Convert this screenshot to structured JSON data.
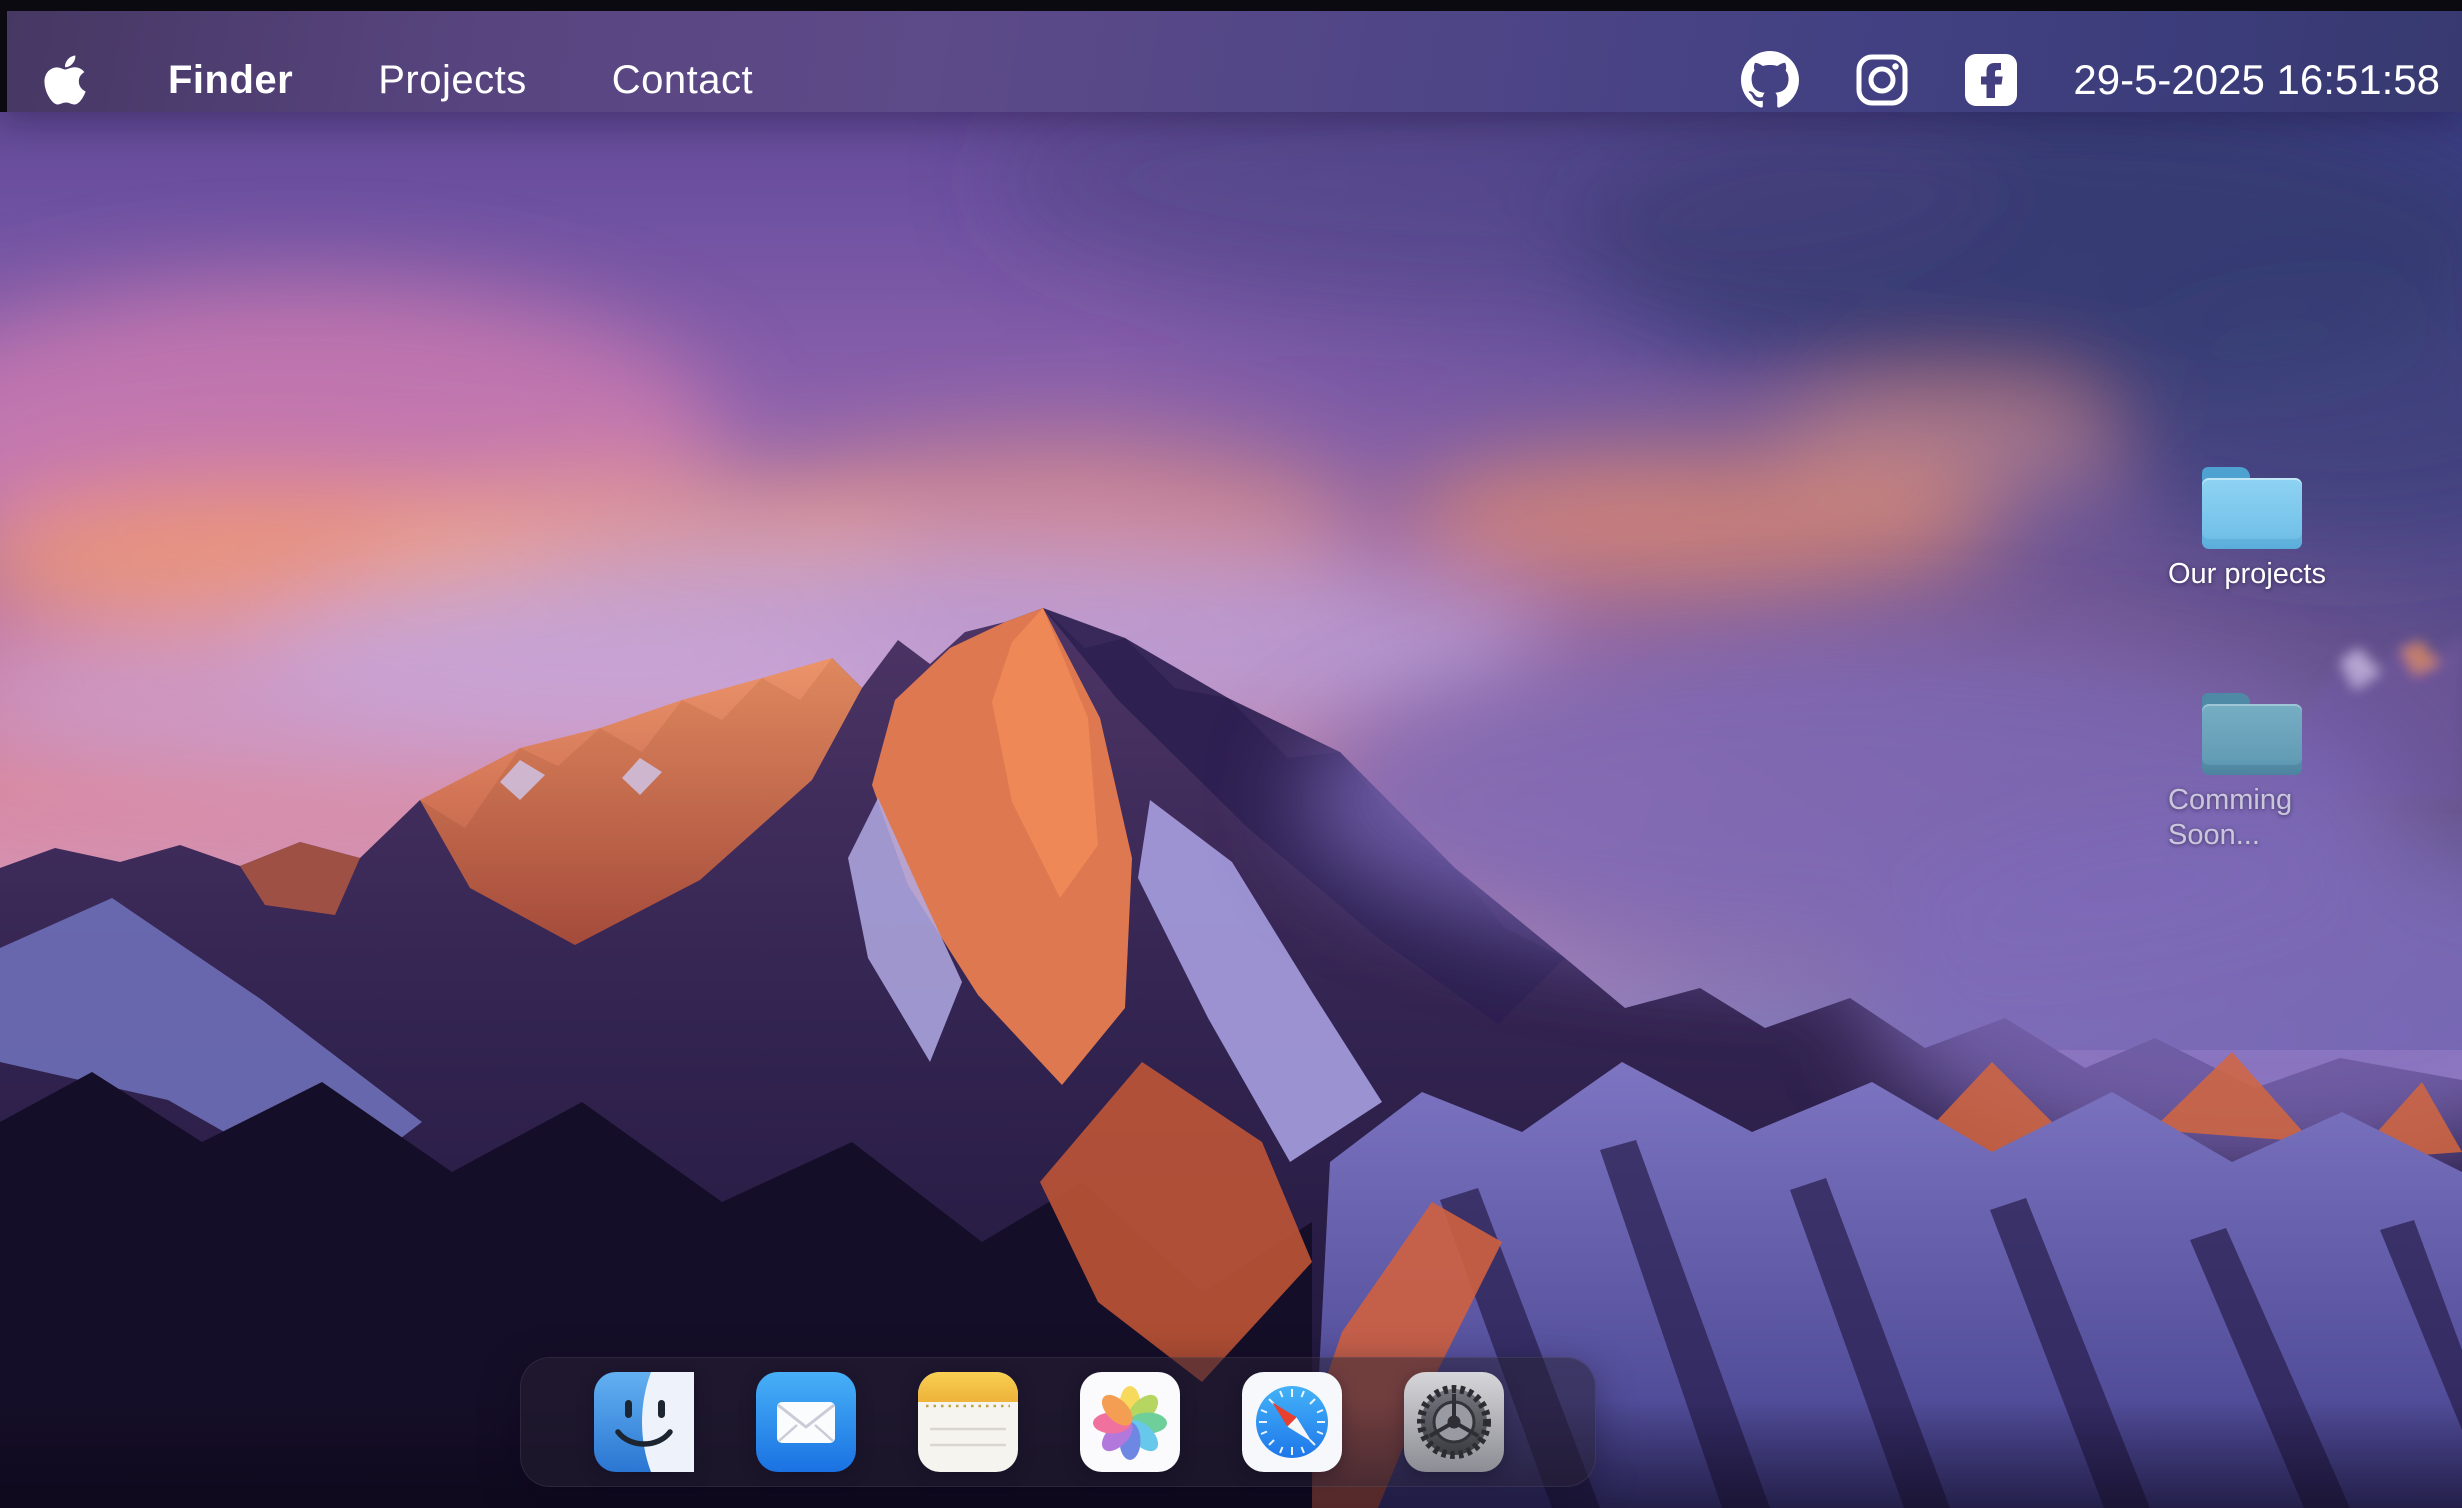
{
  "menu_bar": {
    "apple_icon": "apple-icon",
    "items": [
      {
        "label": "Finder",
        "active": true
      },
      {
        "label": "Projects",
        "active": false
      },
      {
        "label": "Contact",
        "active": false
      }
    ],
    "social_icons": [
      "github-icon",
      "instagram-icon",
      "facebook-icon"
    ],
    "clock": "29-5-2025 16:51:58"
  },
  "desktop": {
    "wallpaper": "sierra-mountain-sunset",
    "folders": [
      {
        "label": "Our projects",
        "icon": "folder-icon",
        "style": "blue"
      },
      {
        "label": "Comming Soon...",
        "icon": "folder-icon",
        "style": "muted"
      }
    ]
  },
  "dock": {
    "items": [
      {
        "name": "finder"
      },
      {
        "name": "mail"
      },
      {
        "name": "notes"
      },
      {
        "name": "photos"
      },
      {
        "name": "safari"
      },
      {
        "name": "settings"
      }
    ]
  },
  "colors": {
    "bar_left": "#463763",
    "bar_right": "#37396f",
    "folder_blue": "#7cc8ec",
    "folder_muted": "#639cb5",
    "dock_bg": "rgba(38,32,52,0.52)",
    "text": "#ffffff",
    "sky_top": "#544189",
    "sky_pink": "#d9889f",
    "rock_lit": "#ef8656",
    "rock_shadow": "#2c2050"
  }
}
